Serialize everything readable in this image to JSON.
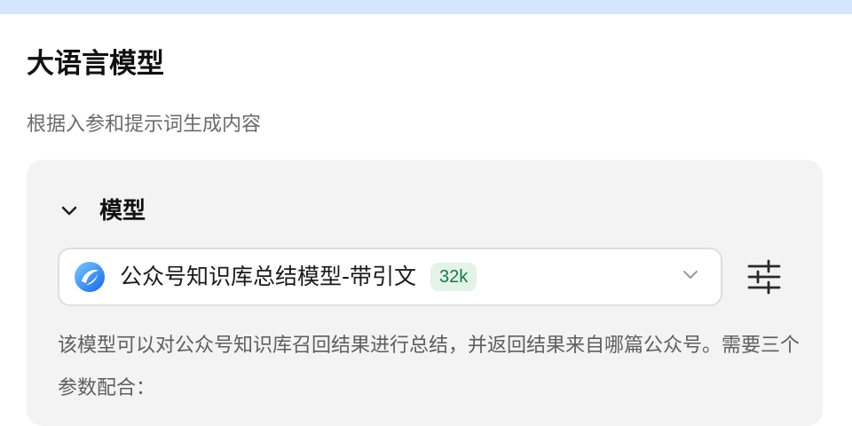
{
  "node": {
    "title": "大语言模型",
    "subtitle": "根据入参和提示词生成内容"
  },
  "model_section": {
    "title": "模型",
    "selected_model": {
      "name": "公众号知识库总结模型-带引文",
      "context_badge": "32k"
    },
    "description": "该模型可以对公众号知识库召回结果进行总结，并返回结果来自哪篇公众号。需要三个参数配合："
  },
  "icons": {
    "collapse": "chevron-down-icon",
    "model_logo": "model-logo-icon",
    "dropdown": "chevron-down-icon",
    "settings": "sliders-icon"
  },
  "colors": {
    "top_strip": "#d4e6fd",
    "panel_background": "#f3f3f3",
    "badge_background": "#e3f3e8",
    "badge_text": "#1c7a45"
  }
}
